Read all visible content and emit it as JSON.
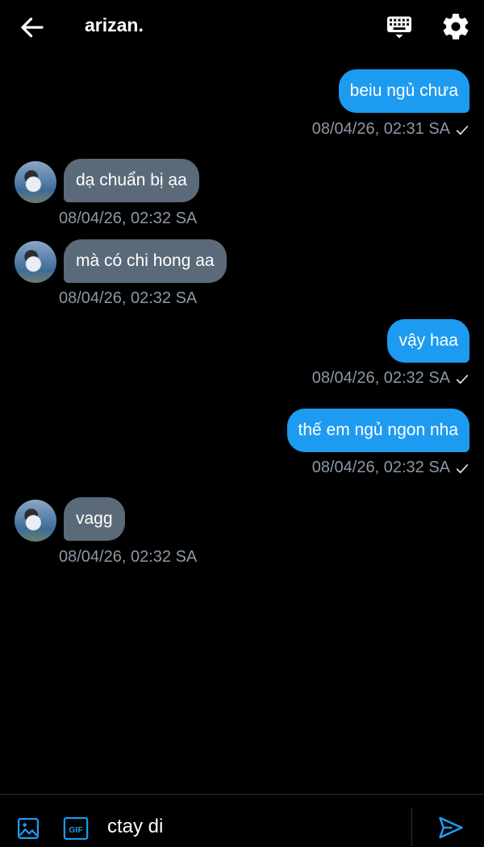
{
  "header": {
    "back_icon": "arrow-left-icon",
    "title": "arizan.",
    "keyboard_icon": "keyboard-icon",
    "settings_icon": "gear-icon"
  },
  "messages": [
    {
      "dir": "out",
      "text": "beiu ngủ chưa",
      "time": "08/04/26, 02:31 SA",
      "status": "sent-check"
    },
    {
      "dir": "in",
      "text": "dạ chuẩn bị ạa",
      "time": "08/04/26, 02:32 SA"
    },
    {
      "dir": "in",
      "text": "mà có chi hong aa",
      "time": "08/04/26, 02:32 SA"
    },
    {
      "dir": "out",
      "text": "vậy haa",
      "time": "08/04/26, 02:32 SA",
      "status": "sent-check"
    },
    {
      "dir": "out",
      "text": "thế em ngủ ngon nha",
      "time": "08/04/26, 02:32 SA",
      "status": "sent-check"
    },
    {
      "dir": "in",
      "text": "vagg",
      "time": "08/04/26, 02:32 SA"
    }
  ],
  "composer": {
    "image_icon": "image-icon",
    "gif_icon": "gif-icon",
    "gif_label": "GIF",
    "input_value": "ctay di",
    "send_icon": "send-icon"
  },
  "colors": {
    "background": "#000000",
    "outgoing": "#1d9bf0",
    "incoming": "#5b6a79",
    "meta": "#8b98a5"
  }
}
